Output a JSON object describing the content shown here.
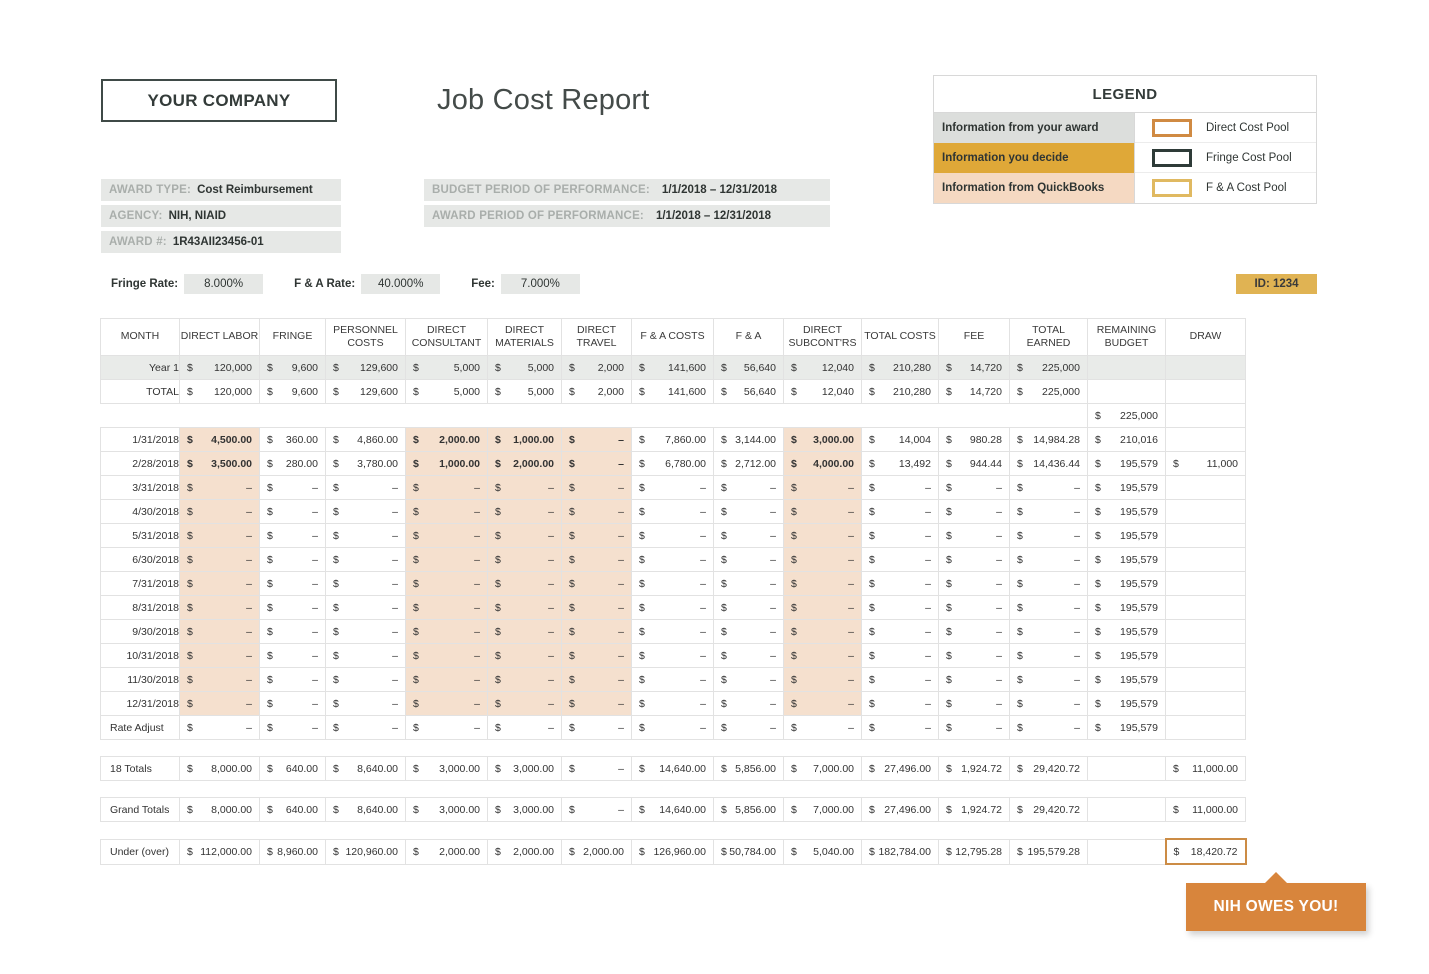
{
  "header": {
    "company": "YOUR COMPANY",
    "title": "Job Cost Report"
  },
  "award_info": [
    {
      "key": "AWARD TYPE:",
      "value": "Cost Reimbursement"
    },
    {
      "key": "AGENCY:",
      "value": "NIH, NIAID"
    },
    {
      "key": "AWARD #:",
      "value": "1R43AII23456-01"
    }
  ],
  "period_info": [
    {
      "key": "BUDGET PERIOD OF PERFORMANCE:",
      "value": "1/1/2018 – 12/31/2018"
    },
    {
      "key": "AWARD PERIOD OF PERFORMANCE:",
      "value": "1/1/2018 – 12/31/2018"
    }
  ],
  "legend": {
    "title": "LEGEND",
    "sources": [
      {
        "label": "Information from your award",
        "color": "#dcdedc"
      },
      {
        "label": "Information you decide",
        "color": "#dfa838"
      },
      {
        "label": "Information from QuickBooks",
        "color": "#f5d9c2"
      }
    ],
    "pools": [
      {
        "label": "Direct Cost Pool",
        "border_color": "#d08a42"
      },
      {
        "label": "Fringe Cost Pool",
        "border_color": "#2e3b38"
      },
      {
        "label": "F & A Cost Pool",
        "border_color": "#e0b961"
      }
    ]
  },
  "rates": [
    {
      "label": "Fringe Rate:",
      "value": "8.000%"
    },
    {
      "label": "F & A Rate:",
      "value": "40.000%"
    },
    {
      "label": "Fee:",
      "value": "7.000%"
    }
  ],
  "id_badge": "ID: 1234",
  "table": {
    "columns": [
      "MONTH",
      "DIRECT LABOR",
      "FRINGE",
      "PERSONNEL COSTS",
      "DIRECT CONSULTANT",
      "DIRECT MATERIALS",
      "DIRECT TRAVEL",
      "F & A COSTS",
      "F & A",
      "DIRECT SUBCONT'RS",
      "TOTAL COSTS",
      "FEE",
      "TOTAL EARNED",
      "REMAINING BUDGET",
      "DRAW"
    ],
    "summary_rows": [
      {
        "label": "Year 1",
        "cells": [
          "120,000",
          "9,600",
          "129,600",
          "5,000",
          "5,000",
          "2,000",
          "141,600",
          "56,640",
          "12,040",
          "210,280",
          "14,720",
          "225,000",
          "",
          ""
        ]
      },
      {
        "label": "TOTAL",
        "cells": [
          "120,000",
          "9,600",
          "129,600",
          "5,000",
          "5,000",
          "2,000",
          "141,600",
          "56,640",
          "12,040",
          "210,280",
          "14,720",
          "225,000",
          "",
          ""
        ]
      }
    ],
    "opening_budget": "225,000",
    "month_rows": [
      {
        "label": "1/31/2018",
        "cells": [
          "4,500.00",
          "360.00",
          "4,860.00",
          "2,000.00",
          "1,000.00",
          "–",
          "7,860.00",
          "3,144.00",
          "3,000.00",
          "14,004",
          "980.28",
          "14,984.28",
          "210,016",
          ""
        ]
      },
      {
        "label": "2/28/2018",
        "cells": [
          "3,500.00",
          "280.00",
          "3,780.00",
          "1,000.00",
          "2,000.00",
          "–",
          "6,780.00",
          "2,712.00",
          "4,000.00",
          "13,492",
          "944.44",
          "14,436.44",
          "195,579",
          "11,000"
        ]
      },
      {
        "label": "3/31/2018",
        "cells": [
          "–",
          "–",
          "–",
          "–",
          "–",
          "–",
          "–",
          "–",
          "–",
          "–",
          "–",
          "–",
          "195,579",
          ""
        ]
      },
      {
        "label": "4/30/2018",
        "cells": [
          "–",
          "–",
          "–",
          "–",
          "–",
          "–",
          "–",
          "–",
          "–",
          "–",
          "–",
          "–",
          "195,579",
          ""
        ]
      },
      {
        "label": "5/31/2018",
        "cells": [
          "–",
          "–",
          "–",
          "–",
          "–",
          "–",
          "–",
          "–",
          "–",
          "–",
          "–",
          "–",
          "195,579",
          ""
        ]
      },
      {
        "label": "6/30/2018",
        "cells": [
          "–",
          "–",
          "–",
          "–",
          "–",
          "–",
          "–",
          "–",
          "–",
          "–",
          "–",
          "–",
          "195,579",
          ""
        ]
      },
      {
        "label": "7/31/2018",
        "cells": [
          "–",
          "–",
          "–",
          "–",
          "–",
          "–",
          "–",
          "–",
          "–",
          "–",
          "–",
          "–",
          "195,579",
          ""
        ]
      },
      {
        "label": "8/31/2018",
        "cells": [
          "–",
          "–",
          "–",
          "–",
          "–",
          "–",
          "–",
          "–",
          "–",
          "–",
          "–",
          "–",
          "195,579",
          ""
        ]
      },
      {
        "label": "9/30/2018",
        "cells": [
          "–",
          "–",
          "–",
          "–",
          "–",
          "–",
          "–",
          "–",
          "–",
          "–",
          "–",
          "–",
          "195,579",
          ""
        ]
      },
      {
        "label": "10/31/2018",
        "cells": [
          "–",
          "–",
          "–",
          "–",
          "–",
          "–",
          "–",
          "–",
          "–",
          "–",
          "–",
          "–",
          "195,579",
          ""
        ]
      },
      {
        "label": "11/30/2018",
        "cells": [
          "–",
          "–",
          "–",
          "–",
          "–",
          "–",
          "–",
          "–",
          "–",
          "–",
          "–",
          "–",
          "195,579",
          ""
        ]
      },
      {
        "label": "12/31/2018",
        "cells": [
          "–",
          "–",
          "–",
          "–",
          "–",
          "–",
          "–",
          "–",
          "–",
          "–",
          "–",
          "–",
          "195,579",
          ""
        ]
      }
    ],
    "rate_adjust": {
      "label": "Rate Adjust",
      "cells": [
        "–",
        "–",
        "–",
        "–",
        "–",
        "–",
        "–",
        "–",
        "–",
        "–",
        "–",
        "–",
        "195,579",
        ""
      ]
    },
    "totals_18": {
      "label": "18 Totals",
      "cells": [
        "8,000.00",
        "640.00",
        "8,640.00",
        "3,000.00",
        "3,000.00",
        "–",
        "14,640.00",
        "5,856.00",
        "7,000.00",
        "27,496.00",
        "1,924.72",
        "29,420.72",
        "",
        "11,000.00"
      ]
    },
    "grand_totals": {
      "label": "Grand Totals",
      "cells": [
        "8,000.00",
        "640.00",
        "8,640.00",
        "3,000.00",
        "3,000.00",
        "–",
        "14,640.00",
        "5,856.00",
        "7,000.00",
        "27,496.00",
        "1,924.72",
        "29,420.72",
        "",
        "11,000.00"
      ]
    },
    "under_over": {
      "label": "Under (over)",
      "cells": [
        "112,000.00",
        "8,960.00",
        "120,960.00",
        "2,000.00",
        "2,000.00",
        "2,000.00",
        "126,960.00",
        "50,784.00",
        "5,040.00",
        "182,784.00",
        "12,795.28",
        "195,579.28",
        "",
        "18,420.72"
      ]
    },
    "currency_symbol": "$"
  },
  "callout": {
    "text": "NIH OWES YOU!",
    "color": "#d8853c"
  }
}
